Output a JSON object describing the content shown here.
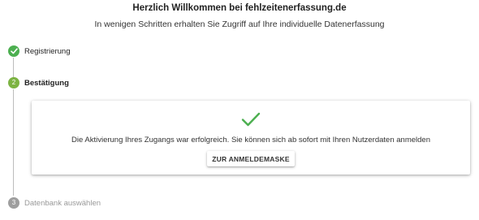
{
  "header": {
    "title": "Herzlich Willkommen bei fehlzeitenerfassung.de",
    "subtitle": "In wenigen Schritten erhalten Sie Zugriff auf Ihre individuelle Datenerfassung"
  },
  "steps": [
    {
      "number": "1",
      "label": "Registrierung",
      "status": "done",
      "icon": "check-icon"
    },
    {
      "number": "2",
      "label": "Bestätigung",
      "status": "active"
    },
    {
      "number": "3",
      "label": "Datenbank auswählen",
      "status": "pending"
    }
  ],
  "card": {
    "icon": "check-icon",
    "message": "Die Aktivierung Ihres Zugangs war erfolgreich. Sie können sich ab sofort mit Ihren Nutzerdaten anmelden",
    "button_label": "ZUR ANMELDEMASKE"
  },
  "colors": {
    "success": "#4caf50",
    "active_step": "#7cb342",
    "pending_step": "#9e9e9e",
    "line": "#bdbdbd"
  }
}
